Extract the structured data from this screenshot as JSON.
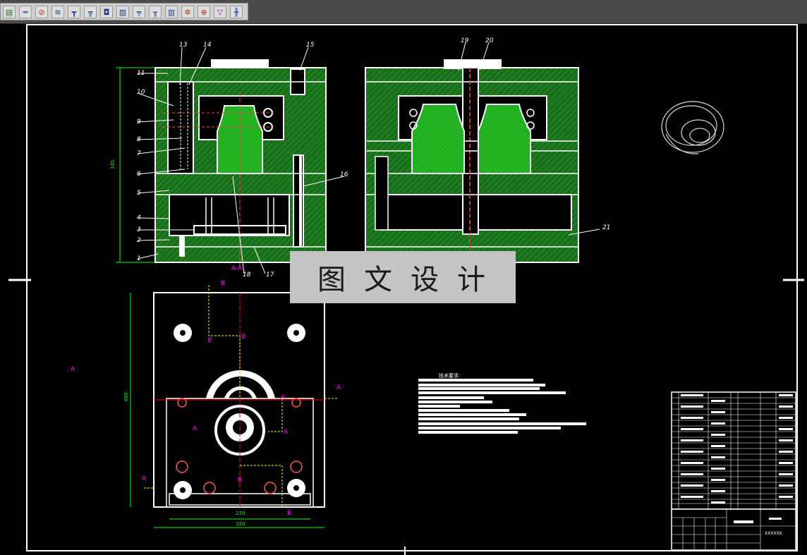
{
  "toolbar": {
    "tools": [
      {
        "icon": "part-list-icon"
      },
      {
        "icon": "horizontal-rule-icon"
      },
      {
        "icon": "circle-slash-icon"
      },
      {
        "icon": "spring-icon"
      },
      {
        "icon": "screw-icon"
      },
      {
        "icon": "bolt-icon"
      },
      {
        "icon": "washer-icon"
      },
      {
        "icon": "hatch-icon"
      },
      {
        "icon": "section-icon"
      },
      {
        "icon": "pin-icon"
      },
      {
        "icon": "bearing-icon"
      },
      {
        "icon": "gear-icon"
      },
      {
        "icon": "center-mark-icon"
      },
      {
        "icon": "countersink-icon"
      },
      {
        "icon": "shaft-icon"
      }
    ]
  },
  "drawing": {
    "part_numbers": [
      "1",
      "2",
      "3",
      "4",
      "5",
      "6",
      "7",
      "8",
      "9",
      "10",
      "11",
      "13",
      "14",
      "15",
      "16",
      "17",
      "18",
      "19",
      "20",
      "21"
    ],
    "section_a_label": "A-A",
    "section_marks": {
      "a": "A",
      "b": "B"
    },
    "dim_height": "345",
    "dim_width_inner": "270",
    "dim_width_outer": "320",
    "dim_plan_height": "400",
    "tech_req_title": "技术要求:",
    "part_title": "XXXXXX"
  },
  "watermark": {
    "text": "图文设计"
  },
  "colors": {
    "background": "#000000",
    "line": "#ffffff",
    "hatch": "#1e7a1e",
    "part_fill": "#22b422",
    "dimension": "#00ff00",
    "leader": "#ffff00",
    "section": "#ff00ff",
    "center": "#ff0000"
  }
}
